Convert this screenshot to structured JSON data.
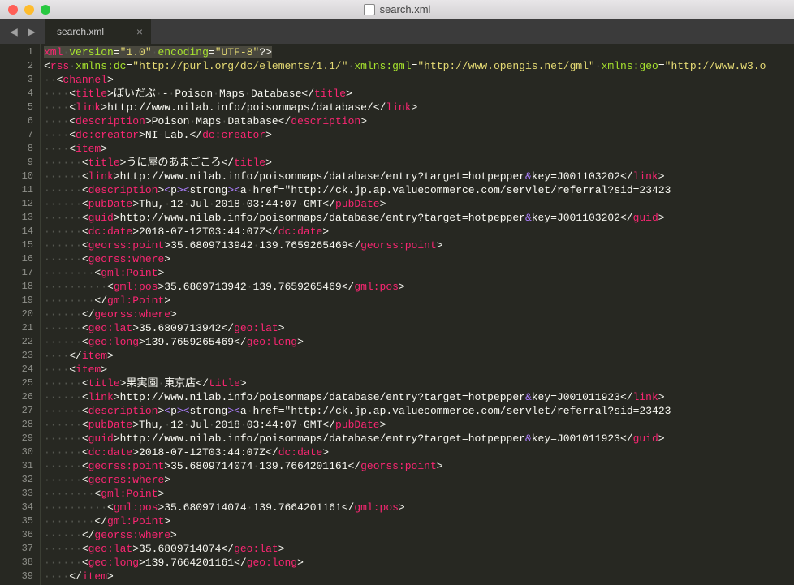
{
  "window": {
    "title": "search.xml"
  },
  "tab": {
    "label": "search.xml",
    "close": "×"
  },
  "nav": {
    "back": "◀",
    "forward": "▶"
  },
  "line_numbers": [
    "1",
    "2",
    "3",
    "4",
    "5",
    "6",
    "7",
    "8",
    "9",
    "10",
    "11",
    "12",
    "13",
    "14",
    "15",
    "16",
    "17",
    "18",
    "19",
    "20",
    "21",
    "22",
    "23",
    "24",
    "25",
    "26",
    "27",
    "28",
    "29",
    "30",
    "31",
    "32",
    "33",
    "34",
    "35",
    "36",
    "37",
    "38",
    "39"
  ],
  "code": {
    "dot": "·",
    "l1": {
      "decl1": "<?",
      "tag": "xml",
      "attr1": "version",
      "val1": "\"1.0\"",
      "attr2": "encoding",
      "val2": "\"UTF-8\"",
      "decl2": "?>"
    },
    "l2": {
      "tag": "rss",
      "a1": "xmlns:dc",
      "v1": "\"http://purl.org/dc/elements/1.1/\"",
      "a2": "xmlns:gml",
      "v2": "\"http://www.opengis.net/gml\"",
      "a3": "xmlns:geo",
      "v3": "\"http://www.w3.o"
    },
    "l3": {
      "tag": "channel"
    },
    "l4": {
      "tag": "title",
      "txt": "ぽいだぶ - Poison Maps Database"
    },
    "l5": {
      "tag": "link",
      "txt": "http://www.nilab.info/poisonmaps/database/"
    },
    "l6": {
      "tag": "description",
      "txt": "Poison Maps Database"
    },
    "l7": {
      "tag": "dc:creator",
      "txt": "NI-Lab."
    },
    "l8": {
      "tag": "item"
    },
    "l9": {
      "tag": "title",
      "txt": "うに屋のあまごころ"
    },
    "l10": {
      "tag": "link",
      "txt1": "http://www.nilab.info/poisonmaps/database/entry?target=hotpepper",
      "amp": "&amp;",
      "txt2": "key=J001103202"
    },
    "l11": {
      "tag": "description",
      "e1": "&lt;",
      "t1": "p",
      "e2": "&gt;&lt;",
      "t2": "strong",
      "e3": "&gt;&lt;",
      "t3": "a href=\"http://ck.jp.ap.valuecommerce.com/servlet/referral?sid=23423"
    },
    "l12": {
      "tag": "pubDate",
      "txt": "Thu, 12 Jul 2018 03:44:07 GMT"
    },
    "l13": {
      "tag": "guid",
      "txt1": "http://www.nilab.info/poisonmaps/database/entry?target=hotpepper",
      "amp": "&amp;",
      "txt2": "key=J001103202"
    },
    "l14": {
      "tag": "dc:date",
      "txt": "2018-07-12T03:44:07Z"
    },
    "l15": {
      "tag": "georss:point",
      "txt": "35.6809713942 139.7659265469"
    },
    "l16": {
      "tag": "georss:where"
    },
    "l17": {
      "tag": "gml:Point"
    },
    "l18": {
      "tag": "gml:pos",
      "txt": "35.6809713942 139.7659265469"
    },
    "l19": {
      "tag": "gml:Point"
    },
    "l20": {
      "tag": "georss:where"
    },
    "l21": {
      "tag": "geo:lat",
      "txt": "35.6809713942"
    },
    "l22": {
      "tag": "geo:long",
      "txt": "139.7659265469"
    },
    "l23": {
      "tag": "item"
    },
    "l24": {
      "tag": "item"
    },
    "l25": {
      "tag": "title",
      "txt": "果実園 東京店"
    },
    "l26": {
      "tag": "link",
      "txt1": "http://www.nilab.info/poisonmaps/database/entry?target=hotpepper",
      "amp": "&amp;",
      "txt2": "key=J001011923"
    },
    "l27": {
      "tag": "description",
      "e1": "&lt;",
      "t1": "p",
      "e2": "&gt;&lt;",
      "t2": "strong",
      "e3": "&gt;&lt;",
      "t3": "a href=\"http://ck.jp.ap.valuecommerce.com/servlet/referral?sid=23423"
    },
    "l28": {
      "tag": "pubDate",
      "txt": "Thu, 12 Jul 2018 03:44:07 GMT"
    },
    "l29": {
      "tag": "guid",
      "txt1": "http://www.nilab.info/poisonmaps/database/entry?target=hotpepper",
      "amp": "&amp;",
      "txt2": "key=J001011923"
    },
    "l30": {
      "tag": "dc:date",
      "txt": "2018-07-12T03:44:07Z"
    },
    "l31": {
      "tag": "georss:point",
      "txt": "35.6809714074 139.7664201161"
    },
    "l32": {
      "tag": "georss:where"
    },
    "l33": {
      "tag": "gml:Point"
    },
    "l34": {
      "tag": "gml:pos",
      "txt": "35.6809714074 139.7664201161"
    },
    "l35": {
      "tag": "gml:Point"
    },
    "l36": {
      "tag": "georss:where"
    },
    "l37": {
      "tag": "geo:lat",
      "txt": "35.6809714074"
    },
    "l38": {
      "tag": "geo:long",
      "txt": "139.7664201161"
    },
    "l39": {
      "tag": "item"
    }
  }
}
